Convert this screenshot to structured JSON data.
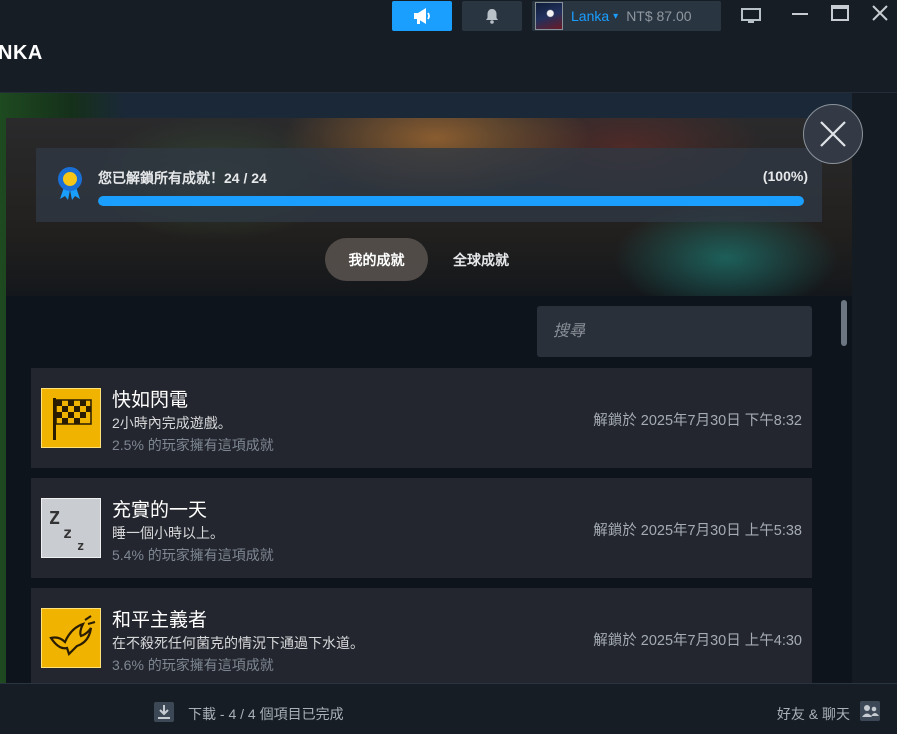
{
  "topbar": {
    "username": "Lanka",
    "wallet": "NT$ 87.00",
    "icons": [
      "megaphone-icon",
      "bell-icon",
      "chevron-down-icon",
      "monitor-icon",
      "minimize-icon",
      "maximize-icon",
      "close-icon"
    ],
    "accent": "#1a9fff"
  },
  "header": {
    "title": "NKA"
  },
  "modal": {
    "progress": {
      "label": "您已解鎖所有成就！24 / 24",
      "percent_label": "(100%)",
      "fraction": 1.0
    },
    "tabs": [
      {
        "label": "我的成就",
        "active": true
      },
      {
        "label": "全球成就",
        "active": false
      }
    ],
    "search": {
      "placeholder": "搜尋",
      "value": ""
    },
    "achievements": [
      {
        "title": "快如閃電",
        "description": "2小時內完成遊戲。",
        "rate": "2.5% 的玩家擁有這項成就",
        "unlocked": "解鎖於 2025年7月30日 下午8:32",
        "icon": "checkered-flag-icon"
      },
      {
        "title": "充實的一天",
        "description": "睡一個小時以上。",
        "rate": "5.4% 的玩家擁有這項成就",
        "unlocked": "解鎖於 2025年7月30日 上午5:38",
        "icon": "sleep-zzz-icon"
      },
      {
        "title": "和平主義者",
        "description": "在不殺死任何菌克的情況下通過下水道。",
        "rate": "3.6% 的玩家擁有這項成就",
        "unlocked": "解鎖於 2025年7月30日 上午4:30",
        "icon": "dove-icon"
      }
    ]
  },
  "bottombar": {
    "downloads": "下載 - 4 / 4 個項目已完成",
    "friends": "好友 & 聊天"
  }
}
